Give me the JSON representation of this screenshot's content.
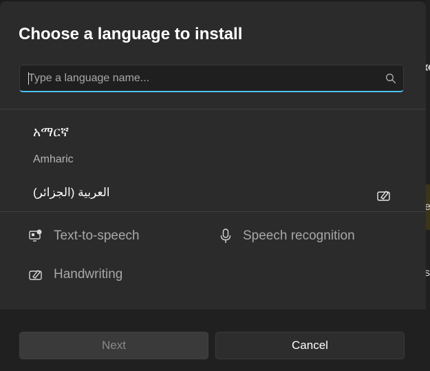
{
  "dialog": {
    "title": "Choose a language to install",
    "search": {
      "placeholder": "Type a language name...",
      "value": ""
    },
    "languages": [
      {
        "native": "አማርኛ",
        "english": "Amharic"
      },
      {
        "native": "العربية (الجزائر)",
        "english": ""
      }
    ],
    "features": {
      "tts": "Text-to-speech",
      "speech": "Speech recognition",
      "handwriting": "Handwriting"
    },
    "buttons": {
      "next": "Next",
      "cancel": "Cancel"
    }
  },
  "background": {
    "glyph_top": "«",
    "glyph_mid": "e",
    "glyph_low": "s"
  },
  "colors": {
    "accent": "#4cc2ff",
    "dialog_bg": "#2b2b2b",
    "footer_bg": "#202020"
  }
}
